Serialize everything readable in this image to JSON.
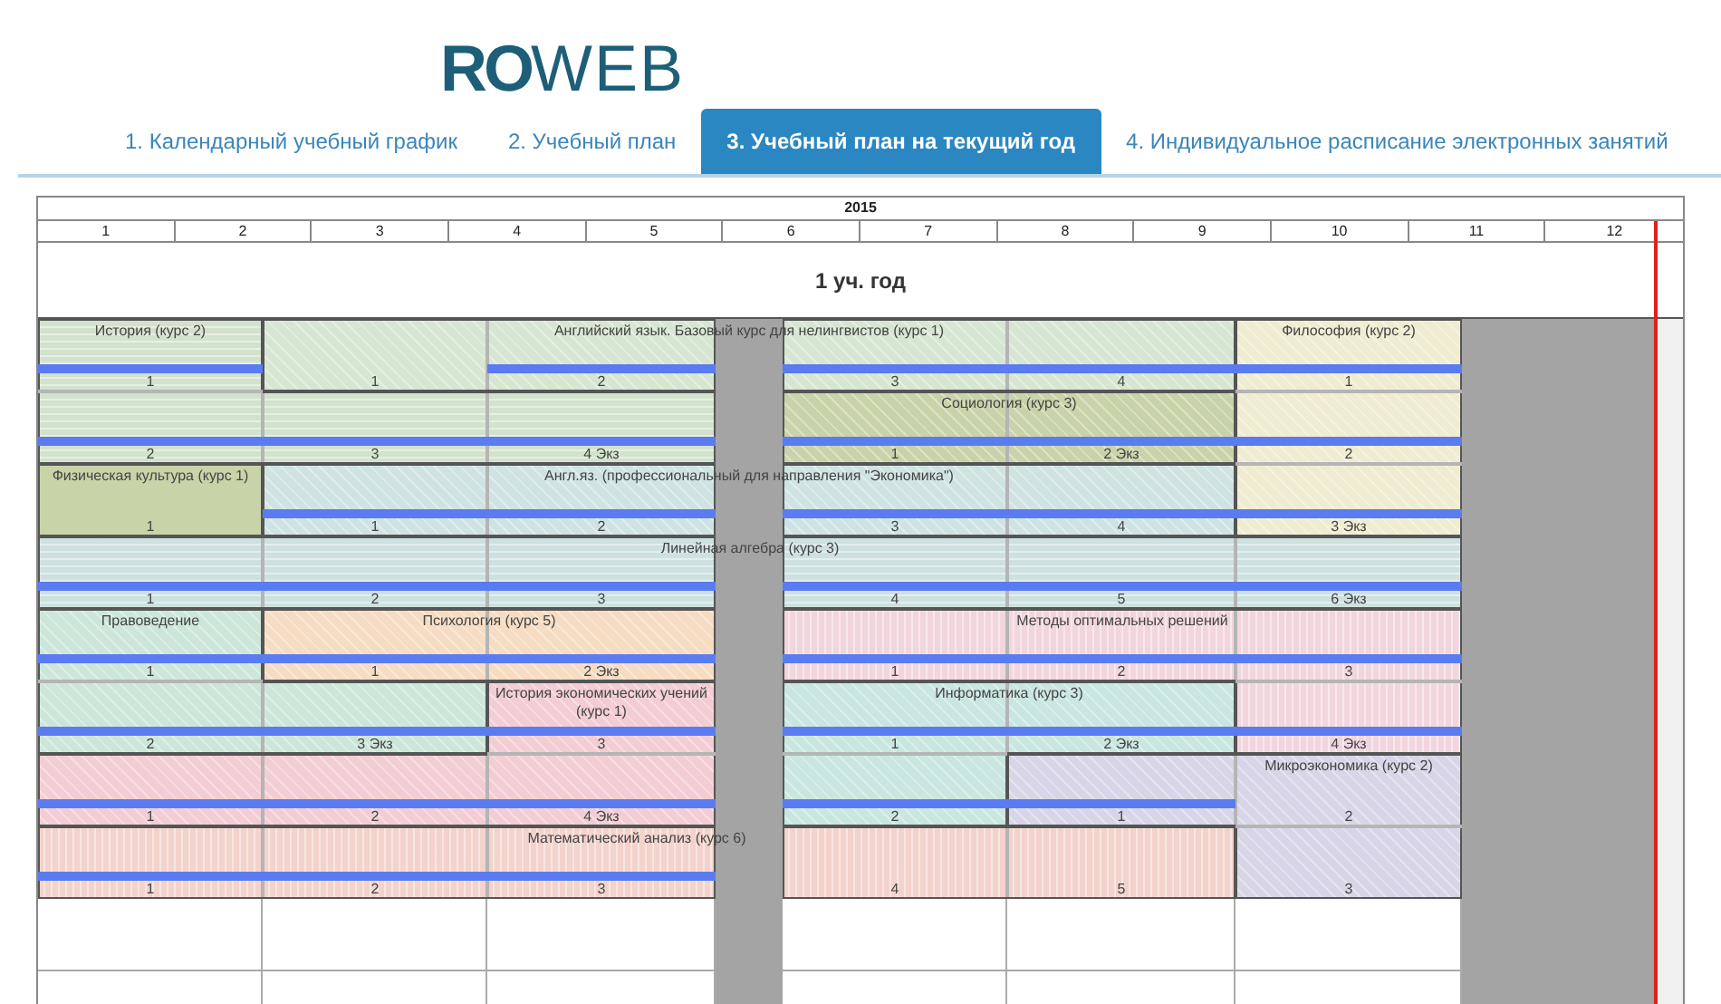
{
  "logo": {
    "parts": [
      "RO",
      "WEB"
    ]
  },
  "tabs": [
    {
      "label": "1. Календарный учебный график",
      "selected": false
    },
    {
      "label": "2. Учебный план",
      "selected": false
    },
    {
      "label": "3. Учебный план на текущий год",
      "selected": true
    },
    {
      "label": "4. Индивидуальное расписание электронных занятий",
      "selected": false
    }
  ],
  "timeline": {
    "year": "2015",
    "months": [
      "1",
      "2",
      "3",
      "4",
      "5",
      "6",
      "7",
      "8",
      "9",
      "10",
      "11",
      "12"
    ],
    "period": "1 уч. год"
  },
  "grid": [
    [
      {
        "title": "История (курс 2)",
        "label": "1",
        "bar": true,
        "color": "#d3e2cc",
        "kind": "horizontal"
      },
      {
        "title": "Английский язык. Базовый курс для нелингвистов (курс 1)",
        "label": "1",
        "bar": false,
        "color": "#d6e6d2",
        "kind": "diagonal"
      },
      {
        "label": "2",
        "bar": true,
        "color": "#d6e6d2",
        "kind": "diagonal"
      },
      {
        "label": "3",
        "bar": true,
        "color": "#d6e6d2",
        "kind": "diagonal"
      },
      {
        "label": "4",
        "bar": true,
        "color": "#d6e6d2",
        "kind": "diagonal"
      },
      {
        "title": "Философия (курс 2)",
        "label": "1",
        "bar": true,
        "color": "#efecd1",
        "kind": "diagonal"
      }
    ],
    [
      {
        "label": "2",
        "bar": true,
        "color": "#d3e2cc",
        "kind": "horizontal"
      },
      {
        "label": "3",
        "bar": true,
        "color": "#d3e2cc",
        "kind": "horizontal"
      },
      {
        "label": "4 Экз",
        "bar": true,
        "color": "#d3e2cc",
        "kind": "horizontal"
      },
      {
        "title": "Социология (курс 3)",
        "label": "1",
        "bar": true,
        "color": "#c9d3a9",
        "kind": "diagonal"
      },
      {
        "label": "2 Экз",
        "bar": true,
        "color": "#c9d3a9",
        "kind": "diagonal"
      },
      {
        "label": "2",
        "bar": true,
        "color": "#efecd1",
        "kind": "diagonal"
      }
    ],
    [
      {
        "title": "Физическая культура (курс 1)",
        "label": "1",
        "bar": false,
        "color": "#c8d3a8",
        "kind": "solid"
      },
      {
        "title": "Англ.яз. (профессиональный для направления \"Экономика\")",
        "label": "1",
        "bar": true,
        "color": "#cfe3e3",
        "kind": "diagonal"
      },
      {
        "label": "2",
        "bar": true,
        "color": "#cfe3e3",
        "kind": "diagonal"
      },
      {
        "label": "3",
        "bar": true,
        "color": "#cfe3e3",
        "kind": "diagonal"
      },
      {
        "label": "4",
        "bar": true,
        "color": "#cfe3e3",
        "kind": "diagonal"
      },
      {
        "label": "3 Экз",
        "bar": true,
        "color": "#efecd1",
        "kind": "diagonal"
      }
    ],
    [
      {
        "title": "Линейная алгебра (курс 3)",
        "label": "1",
        "bar": true,
        "color": "#cde1e0",
        "kind": "horizontal"
      },
      {
        "label": "2",
        "bar": true,
        "color": "#cde1e0",
        "kind": "horizontal"
      },
      {
        "label": "3",
        "bar": true,
        "color": "#cde1e0",
        "kind": "horizontal"
      },
      {
        "label": "4",
        "bar": true,
        "color": "#cde1e0",
        "kind": "horizontal"
      },
      {
        "label": "5",
        "bar": true,
        "color": "#cde1e0",
        "kind": "horizontal"
      },
      {
        "label": "6 Экз",
        "bar": true,
        "color": "#cde1e0",
        "kind": "horizontal"
      }
    ],
    [
      {
        "title": "Правоведение",
        "label": "1",
        "bar": true,
        "color": "#cde6da",
        "kind": "diagonal"
      },
      {
        "title": "Психология (курс 5)",
        "label": "1",
        "bar": true,
        "color": "#f5dcc2",
        "kind": "diagonal"
      },
      {
        "label": "2 Экз",
        "bar": true,
        "color": "#f5dcc2",
        "kind": "diagonal"
      },
      {
        "title": "Методы оптимальных решений",
        "label": "1",
        "bar": true,
        "color": "#f2d6dd",
        "kind": "vertical"
      },
      {
        "label": "2",
        "bar": true,
        "color": "#f2d6dd",
        "kind": "vertical"
      },
      {
        "label": "3",
        "bar": true,
        "color": "#f2d6dd",
        "kind": "vertical"
      }
    ],
    [
      {
        "label": "2",
        "bar": true,
        "color": "#cde6da",
        "kind": "diagonal"
      },
      {
        "label": "3 Экз",
        "bar": true,
        "color": "#cde6da",
        "kind": "diagonal"
      },
      {
        "title": "История экономических учений (курс 1)",
        "label": "3",
        "bar": true,
        "color": "#f2cdd3",
        "kind": "diagonal"
      },
      {
        "title": "Информатика (курс 3)",
        "label": "1",
        "bar": true,
        "color": "#c9e6e1",
        "kind": "diagonal"
      },
      {
        "label": "2 Экз",
        "bar": true,
        "color": "#c9e6e1",
        "kind": "diagonal"
      },
      {
        "label": "4 Экз",
        "bar": true,
        "color": "#f2d6dd",
        "kind": "vertical"
      }
    ],
    [
      {
        "label": "1",
        "bar": true,
        "color": "#f2cdd3",
        "kind": "diagonal"
      },
      {
        "label": "2",
        "bar": true,
        "color": "#f2cdd3",
        "kind": "diagonal"
      },
      {
        "label": "4 Экз",
        "bar": true,
        "color": "#f2cdd3",
        "kind": "diagonal"
      },
      {
        "label": "2",
        "bar": true,
        "color": "#c9e6e1",
        "kind": "diagonal"
      },
      {
        "label": "1",
        "bar": true,
        "color": "#d7d5e7",
        "kind": "diagonal"
      },
      {
        "title": "Микроэкономика (курс 2)",
        "label": "2",
        "bar": false,
        "color": "#d7d5e7",
        "kind": "diagonal"
      }
    ],
    [
      {
        "title": "Математический анализ (курс 6)",
        "label": "1",
        "bar": true,
        "color": "#f3d3cb",
        "kind": "vertical"
      },
      {
        "label": "2",
        "bar": true,
        "color": "#f3d3cb",
        "kind": "vertical"
      },
      {
        "label": "3",
        "bar": true,
        "color": "#f3d3cb",
        "kind": "vertical"
      },
      {
        "label": "4",
        "bar": false,
        "color": "#f3d3cb",
        "kind": "vertical"
      },
      {
        "label": "5",
        "bar": false,
        "color": "#f3d3cb",
        "kind": "vertical"
      },
      {
        "label": "3",
        "bar": false,
        "color": "#d7d5e7",
        "kind": "diagonal"
      }
    ]
  ]
}
